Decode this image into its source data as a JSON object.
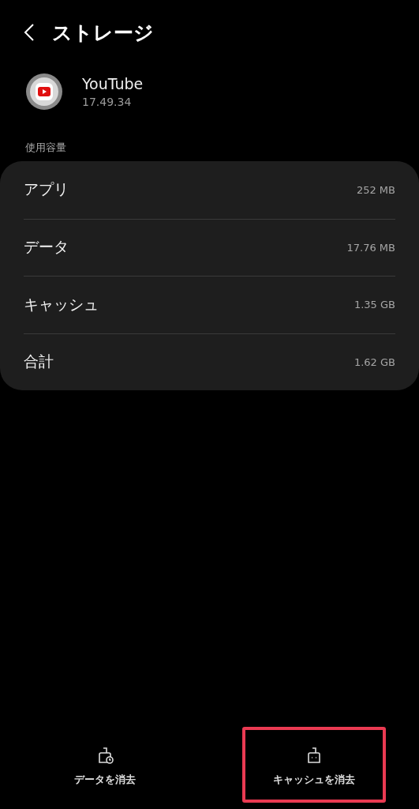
{
  "header": {
    "title": "ストレージ"
  },
  "app": {
    "name": "YouTube",
    "version": "17.49.34"
  },
  "section": {
    "label": "使用容量"
  },
  "usage": [
    {
      "label": "アプリ",
      "value": "252 MB"
    },
    {
      "label": "データ",
      "value": "17.76 MB"
    },
    {
      "label": "キャッシュ",
      "value": "1.35 GB"
    },
    {
      "label": "合計",
      "value": "1.62 GB"
    }
  ],
  "actions": [
    {
      "kind": "clear-data",
      "label": "データを消去",
      "highlighted": false
    },
    {
      "kind": "clear-cache",
      "label": "キャッシュを消去",
      "highlighted": true
    }
  ]
}
